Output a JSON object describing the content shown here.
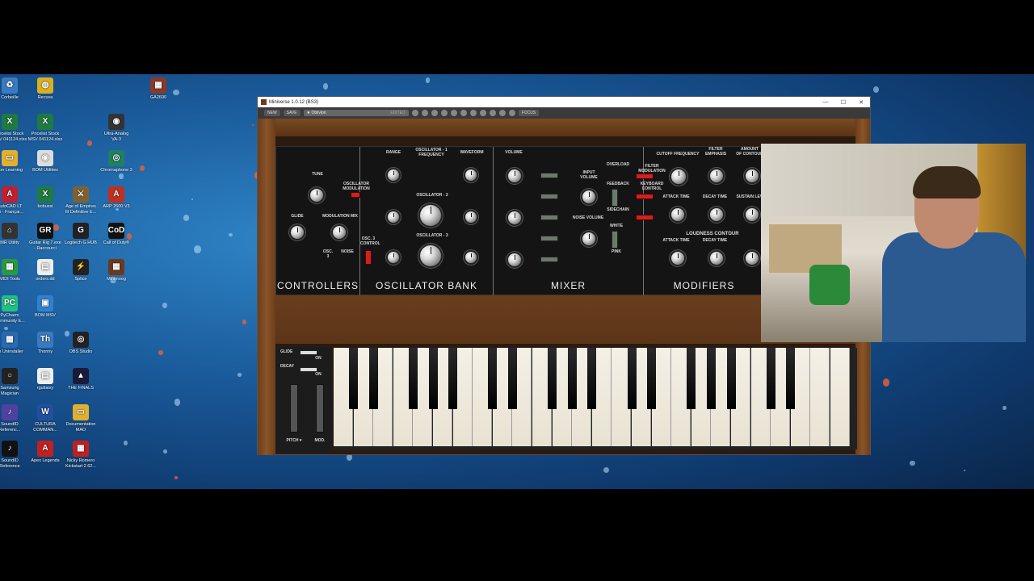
{
  "desktop": {
    "icons": [
      {
        "label": "Corbeille",
        "color": "#3a7ac0",
        "glyph": "♻"
      },
      {
        "label": "Recuva",
        "color": "#d8b020",
        "glyph": "◍"
      },
      {
        "label": "Pricelist Stock\nMSV 041124.xlsx",
        "color": "#1e7a40",
        "glyph": "X"
      },
      {
        "label": "Pricelist Stock\nMSV 041124.xlsx",
        "color": "#1e7a40",
        "glyph": "X"
      },
      {
        "label": "hon Learning",
        "color": "#e0b030",
        "glyph": "▭"
      },
      {
        "label": "BOM Utilities",
        "color": "#dddddd",
        "glyph": "◉"
      },
      {
        "label": "AutoCAD LT\n25 - Françai...",
        "color": "#c02030",
        "glyph": "A"
      },
      {
        "label": "bobussi",
        "color": "#1e7a40",
        "glyph": "X"
      },
      {
        "label": "Age of Empires\nIII Definitive E...",
        "color": "#806030",
        "glyph": "⚔"
      },
      {
        "label": "MR Utility",
        "color": "#333333",
        "glyph": "⌂"
      },
      {
        "label": "Guitar Rig 7.exe\n- Raccourci",
        "color": "#111111",
        "glyph": "GR"
      },
      {
        "label": "Logitech G HUB",
        "color": "#222222",
        "glyph": "G"
      },
      {
        "label": "Call of Duty®",
        "color": "#111111",
        "glyph": "CoD"
      },
      {
        "label": "MIDI Tools",
        "color": "#2a9a40",
        "glyph": "▦"
      },
      {
        "label": "orders.dd",
        "color": "#eeeeee",
        "glyph": "▤"
      },
      {
        "label": "Splice",
        "color": "#222222",
        "glyph": "⚡"
      },
      {
        "label": "PyCharm\nCommunity E...",
        "color": "#20c080",
        "glyph": "PC"
      },
      {
        "label": "BOM MSV",
        "color": "#3080d0",
        "glyph": "▣"
      },
      {
        "label": "no Uninstaller",
        "color": "#2a6ab0",
        "glyph": "▦"
      },
      {
        "label": "Thonny",
        "color": "#3a7ac0",
        "glyph": "Th"
      },
      {
        "label": "OBS Studio",
        "color": "#222222",
        "glyph": "◎"
      },
      {
        "label": "Samsung\nMagician",
        "color": "#222222",
        "glyph": "○"
      },
      {
        "label": "rgutiaixy",
        "color": "#eeeeee",
        "glyph": "▤"
      },
      {
        "label": "THE FINALS",
        "color": "#1a1a3a",
        "glyph": "▲"
      },
      {
        "label": "SoundID\nReferenc...",
        "color": "#5040a0",
        "glyph": "♪"
      },
      {
        "label": "CULTURA\nCOMMAN...",
        "color": "#2050a0",
        "glyph": "W"
      },
      {
        "label": "Documentation\nMAO",
        "color": "#e0b030",
        "glyph": "▭"
      },
      {
        "label": "SoundID\nReference",
        "color": "#111111",
        "glyph": "♪"
      },
      {
        "label": "Apex Legends",
        "color": "#c02020",
        "glyph": "A"
      },
      {
        "label": "Nicky Romero\nKickstart 2 62...",
        "color": "#c02020",
        "glyph": "▦"
      },
      {
        "label": "GA2600",
        "color": "#8a3a2a",
        "glyph": "▦"
      },
      {
        "label": "Ultra-Analog\nVA-3",
        "color": "#333333",
        "glyph": "◉"
      },
      {
        "label": "Chromaphone 3",
        "color": "#208060",
        "glyph": "◎"
      },
      {
        "label": "ARP 2600 V3",
        "color": "#c03020",
        "glyph": "A"
      },
      {
        "label": "Minimoog",
        "color": "#6a3a20",
        "glyph": "▦"
      }
    ]
  },
  "window": {
    "title": "Miniverse 1.0.12 (BS3)",
    "minimize": "—",
    "maximize": "☐",
    "close": "✕",
    "toolbar": {
      "new_label": "NEW",
      "save_label": "SAVE",
      "preset_name": "★ Oblivion",
      "edited_label": "EDITED",
      "focus_label": "FOCUS"
    }
  },
  "synth": {
    "sections": {
      "controllers": "CONTROLLERS",
      "oscillator_bank": "OSCILLATOR  BANK",
      "mixer": "MIXER",
      "modifiers": "MODIFIERS"
    },
    "labels": {
      "tune": "TUNE",
      "osc_mod": "OSCILLATOR\nMODULATION",
      "glide": "GLIDE",
      "mod_mix": "MODULATION MIX",
      "osc3": "OSC. 3",
      "noise": "NOISE",
      "range": "RANGE",
      "osc1_freq": "OSCILLATOR - 1\nFREQUENCY",
      "waveform": "WAVEFORM",
      "osc2": "OSCILLATOR - 2",
      "osc3_label": "OSCILLATOR - 3",
      "osc3_control": "OSC. 3\nCONTROL",
      "volume": "VOLUME",
      "input_volume": "INPUT\nVOLUME",
      "overload": "OVERLOAD",
      "feedback": "FEEDBACK",
      "sidechain": "SIDECHAIN",
      "noise_volume": "NOISE VOLUME",
      "white": "WHITE",
      "pink": "PINK",
      "filter_mod": "FILTER\nMODULATION",
      "keyboard_control": "KEYBOARD\nCONTROL",
      "cutoff": "CUTOFF FREQUENCY",
      "filter_emphasis": "FILTER\nEMPHASIS",
      "amount_contour": "AMOUNT\nOF CONTOUR",
      "attack_time": "ATTACK TIME",
      "decay_time": "DECAY TIME",
      "sustain_level": "SUSTAIN LEVEL",
      "loudness_contour": "LOUDNESS CONTOUR",
      "on": "ON"
    },
    "left_controls": {
      "glide": "GLIDE",
      "decay": "DECAY",
      "on": "ON",
      "pitch": "PITCH ▾",
      "mod": "MOD."
    }
  },
  "colors": {
    "accent_red": "#d02020",
    "wood": "#6a3e1c",
    "panel": "#141414"
  }
}
